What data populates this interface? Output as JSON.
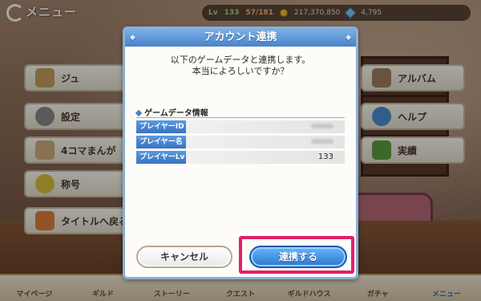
{
  "header": {
    "menu_title": "メニュー",
    "level_label": "Lv",
    "level_value": "133",
    "stamina": "57/181",
    "mana": "217,370,850",
    "jewels": "4,795"
  },
  "menu_left": [
    {
      "label": "ジュ"
    },
    {
      "label": "設定"
    },
    {
      "label": "4コマまんが"
    },
    {
      "label": "称号"
    },
    {
      "label": "タイトルへ戻る"
    }
  ],
  "menu_right": [
    {
      "label": "アルバム"
    },
    {
      "label": "ヘルプ"
    },
    {
      "label": "実績"
    }
  ],
  "bottom_nav": [
    {
      "label": "マイページ"
    },
    {
      "label": "ギルド"
    },
    {
      "label": "ストーリー"
    },
    {
      "label": "クエスト"
    },
    {
      "label": "ギルドハウス"
    },
    {
      "label": "ガチャ"
    },
    {
      "label": "メニュー"
    }
  ],
  "dialog": {
    "title": "アカウント連携",
    "message_line1": "以下のゲームデータと連携します。",
    "message_line2": "本当によろしいですか？",
    "section_title": "ゲームデータ情報",
    "rows": [
      {
        "label": "プレイヤーID",
        "value": ""
      },
      {
        "label": "プレイヤー名",
        "value": ""
      },
      {
        "label": "プレイヤーLv",
        "value": "133"
      }
    ],
    "cancel_label": "キャンセル",
    "confirm_label": "連携する"
  },
  "colors": {
    "accent_blue": "#3a72c0",
    "highlight": "#e0206a"
  }
}
